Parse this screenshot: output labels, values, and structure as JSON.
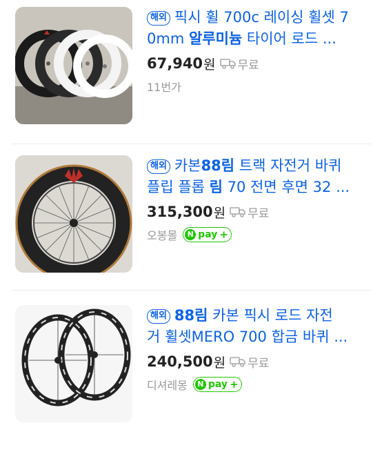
{
  "products": [
    {
      "badge": "해외",
      "title_line1_a": "픽시 휠 700c 레이싱 휠셋 7",
      "title_line2_a": "0mm ",
      "title_line2_b": "알루미늄",
      "title_line2_c": " 타이어 로드 ...",
      "price": "67,940",
      "currency": "원",
      "shipping": "무료",
      "seller": "11번가",
      "truck_icon": "truck-icon"
    },
    {
      "badge": "해외",
      "title_line1_a": "카본",
      "title_line1_b": "88림",
      "title_line1_c": " 트랙 자전거 바퀴",
      "title_line2_a": "플립 플롭 ",
      "title_line2_b": "림",
      "title_line2_c": " 70 전면 후면 32 ...",
      "price": "315,300",
      "currency": "원",
      "shipping": "무료",
      "seller": "오봉몰",
      "npay_label": "pay",
      "npay_n": "N",
      "npay_plus": "+",
      "truck_icon": "truck-icon"
    },
    {
      "badge": "해외",
      "title_line1_b": "88림",
      "title_line1_c": " 카본 픽시 로드 자전",
      "title_line2_a": "거 휠셋MERO 700 합금 바퀴 ...",
      "price": "240,500",
      "currency": "원",
      "shipping": "무료",
      "seller": "디셔레몽",
      "npay_label": "pay",
      "npay_n": "N",
      "npay_plus": "+",
      "truck_icon": "truck-icon"
    }
  ],
  "colors": {
    "link_blue": "#0b62e6",
    "price_black": "#222222",
    "muted_gray": "#999999",
    "npay_green": "#1ec800"
  }
}
